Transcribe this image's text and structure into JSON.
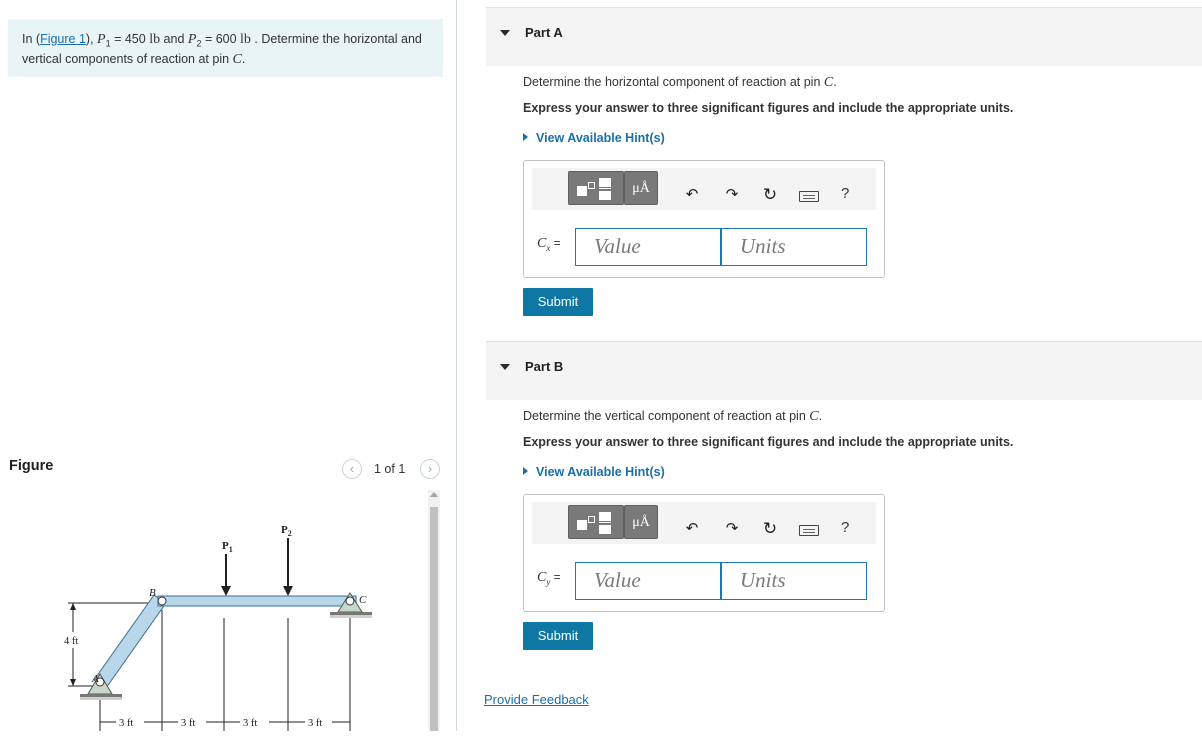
{
  "problem": {
    "prefix": "In (",
    "figure_link": "Figure 1",
    "after_link": "), ",
    "p1_symbol": "P",
    "p1_sub": "1",
    "p1_value": " = 450 ",
    "p1_unit": "lb",
    "and": " and ",
    "p2_symbol": "P",
    "p2_sub": "2",
    "p2_value": " = 600 ",
    "p2_unit": "lb",
    "suffix": " . Determine the horizontal and vertical components of reaction at pin ",
    "pin": "C",
    "end": "."
  },
  "figure": {
    "title": "Figure",
    "pager": "1 of 1",
    "prev_icon": "chevron-left-icon",
    "next_icon": "chevron-right-icon",
    "labels": {
      "p1": "P",
      "p1_sub": "1",
      "p2": "P",
      "p2_sub": "2",
      "a": "A",
      "b": "B",
      "c": "C",
      "height": "4 ft",
      "dim1": "3 ft",
      "dim2": "3 ft",
      "dim3": "3 ft",
      "dim4": "3 ft"
    }
  },
  "parts": [
    {
      "title": "Part A",
      "question": "Determine the horizontal component of reaction at pin ",
      "question_var": "C",
      "question_end": ".",
      "instruction": "Express your answer to three significant figures and include the appropriate units.",
      "hint": "View Available Hint(s)",
      "mu_label": "μÅ",
      "var_symbol": "C",
      "var_sub": "x",
      "var_eq": " =",
      "value_placeholder": "Value",
      "units_placeholder": "Units",
      "help": "?",
      "submit": "Submit"
    },
    {
      "title": "Part B",
      "question": "Determine the vertical component of reaction at pin ",
      "question_var": "C",
      "question_end": ".",
      "instruction": "Express your answer to three significant figures and include the appropriate units.",
      "hint": "View Available Hint(s)",
      "mu_label": "μÅ",
      "var_symbol": "C",
      "var_sub": "y",
      "var_eq": " =",
      "value_placeholder": "Value",
      "units_placeholder": "Units",
      "help": "?",
      "submit": "Submit"
    }
  ],
  "feedback": "Provide Feedback",
  "colors": {
    "link": "#1a6fa8",
    "submit_bg": "#0f77a3",
    "problem_bg": "#e9f4f6",
    "member_fill": "#b9d7ea"
  }
}
